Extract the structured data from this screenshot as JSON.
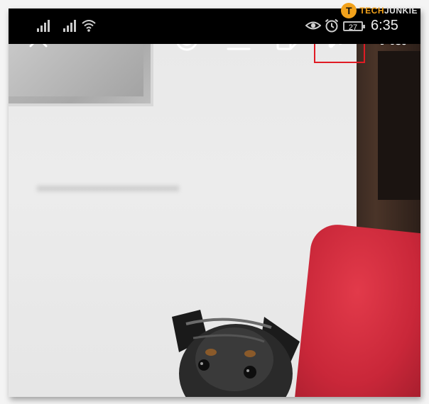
{
  "status_bar": {
    "battery_level": "27",
    "time": "6:35",
    "icons": [
      "signal-icon",
      "signal-icon",
      "wifi-icon",
      "eye-icon",
      "alarm-icon",
      "battery-icon"
    ]
  },
  "watermark": {
    "logo_letter": "T",
    "brand_part1": "TECH",
    "brand_part2": "JUNKIE"
  },
  "toolbar": {
    "close_icon": "close-icon",
    "effects_icon": "face-sparkle-icon",
    "save_icon": "download-icon",
    "sticker_icon": "sticker-icon",
    "draw_icon": "draw-squiggle-icon",
    "text_label": "Aa"
  },
  "colors": {
    "highlight": "#e01b24",
    "toolbar_icon": "#ffffff",
    "status_background": "#000000",
    "watermark_accent": "#f2a21b"
  }
}
